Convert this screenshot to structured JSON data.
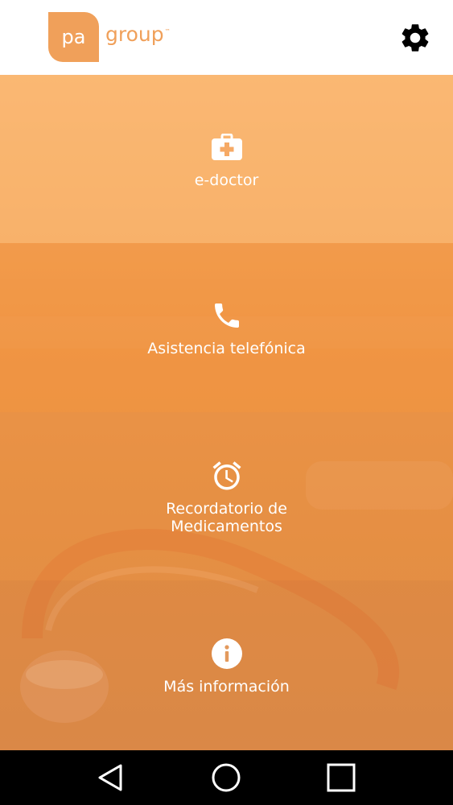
{
  "header": {
    "logo_mark": "pa",
    "logo_word": "group",
    "logo_tm": "™",
    "settings_icon": "gear-icon"
  },
  "menu": {
    "items": [
      {
        "label": "e-doctor",
        "icon": "first-aid-kit-icon"
      },
      {
        "label": "Asistencia telefónica",
        "icon": "phone-icon"
      },
      {
        "label": "Recordatorio de\nMedicamentos",
        "icon": "alarm-clock-icon"
      },
      {
        "label": "Más información",
        "icon": "info-icon"
      }
    ]
  },
  "navbar": {
    "back_icon": "back-triangle-icon",
    "home_icon": "home-circle-icon",
    "recents_icon": "recents-square-icon"
  },
  "colors": {
    "brand_orange": "#f0a05a",
    "tile_text": "#ffffff",
    "navbar_bg": "#000000"
  }
}
